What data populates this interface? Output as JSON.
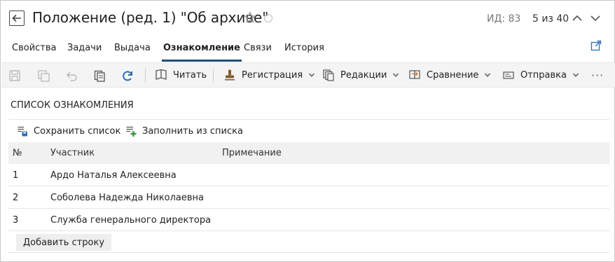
{
  "header": {
    "title": "Положение (ред. 1) \"Об архиве\"",
    "id_label": "ИД: 83",
    "pager": "5 из 40"
  },
  "tabs": [
    {
      "label": "Свойства",
      "active": false
    },
    {
      "label": "Задачи",
      "active": false
    },
    {
      "label": "Выдача",
      "active": false
    },
    {
      "label": "Ознакомление",
      "active": true
    },
    {
      "label": "Связи",
      "active": false
    },
    {
      "label": "История",
      "active": false
    }
  ],
  "toolbar": {
    "read": "Читать",
    "registration": "Регистрация",
    "editions": "Редакции",
    "compare": "Сравнение",
    "send": "Отправка",
    "more": "···"
  },
  "list": {
    "title": "СПИСОК ОЗНАКОМЛЕНИЯ",
    "save_list": "Сохранить список",
    "fill_from_list": "Заполнить из списка",
    "columns": {
      "num": "№",
      "participant": "Участник",
      "note": "Примечание"
    },
    "rows": [
      {
        "num": "1",
        "participant": "Ардо Наталья Алексеевна",
        "note": ""
      },
      {
        "num": "2",
        "participant": "Соболева Надежда Николаевна",
        "note": ""
      },
      {
        "num": "3",
        "participant": "Служба генерального директора",
        "note": ""
      }
    ],
    "add_row": "Добавить строку"
  },
  "colors": {
    "accent": "#1f4d7a",
    "toolbar_bg": "#f4f4f4",
    "table_head_bg": "#f1f1f1",
    "refresh_blue": "#2a6fb0",
    "green_plus": "#3a9a3a"
  }
}
